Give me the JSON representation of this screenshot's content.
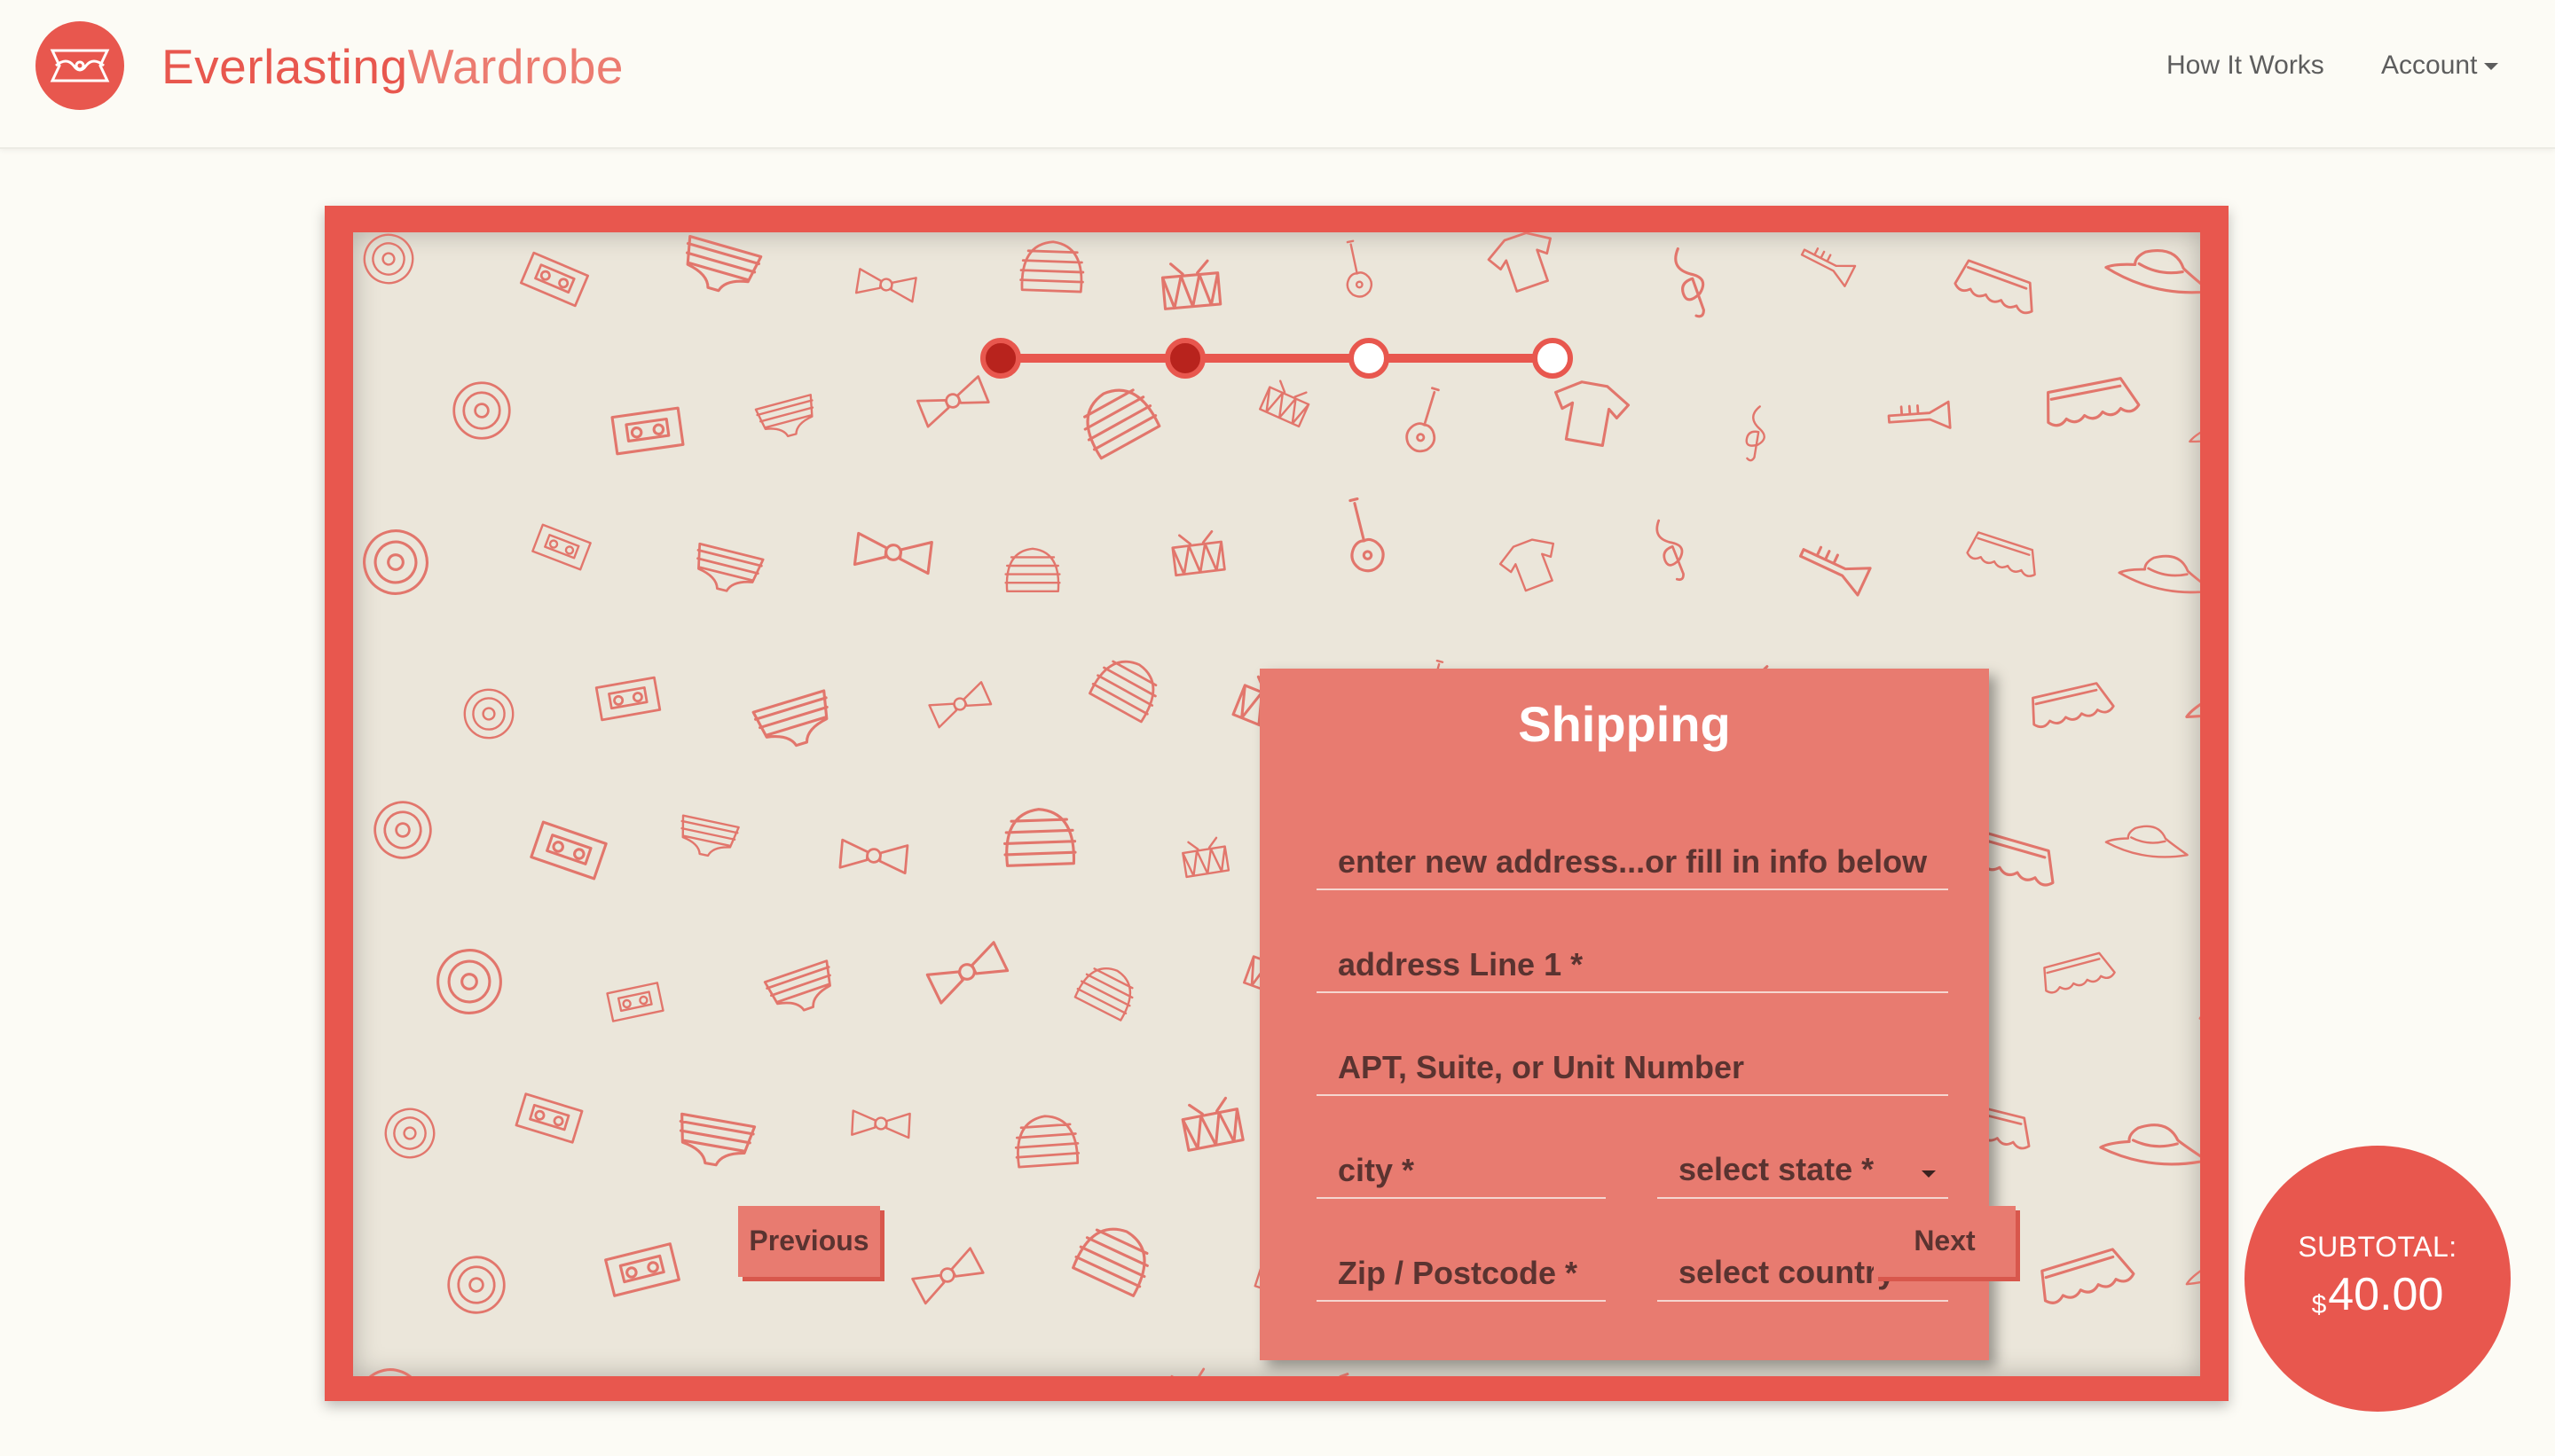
{
  "header": {
    "brand_part1": "Everlasting",
    "brand_part2": "Wardrobe",
    "nav": {
      "how_it_works": "How It Works",
      "account": "Account"
    }
  },
  "progress": {
    "steps_total": 4,
    "steps_completed": 2
  },
  "shipping": {
    "title": "Shipping",
    "address_search_placeholder": "enter new address...or fill in info below",
    "address_line1_placeholder": "address Line 1 *",
    "apt_placeholder": "APT, Suite, or Unit Number",
    "city_placeholder": "city *",
    "state_select": "select state *",
    "zip_placeholder": "Zip / Postcode *",
    "country_select": "select country *"
  },
  "buttons": {
    "previous": "Previous",
    "next": "Next"
  },
  "subtotal": {
    "label": "SUBTOTAL:",
    "currency": "$",
    "amount": "40.00"
  },
  "colors": {
    "accent": "#e8574e",
    "card": "#e87b70",
    "pattern_bg": "#ebe6da",
    "page_bg": "#fcfbf5"
  }
}
